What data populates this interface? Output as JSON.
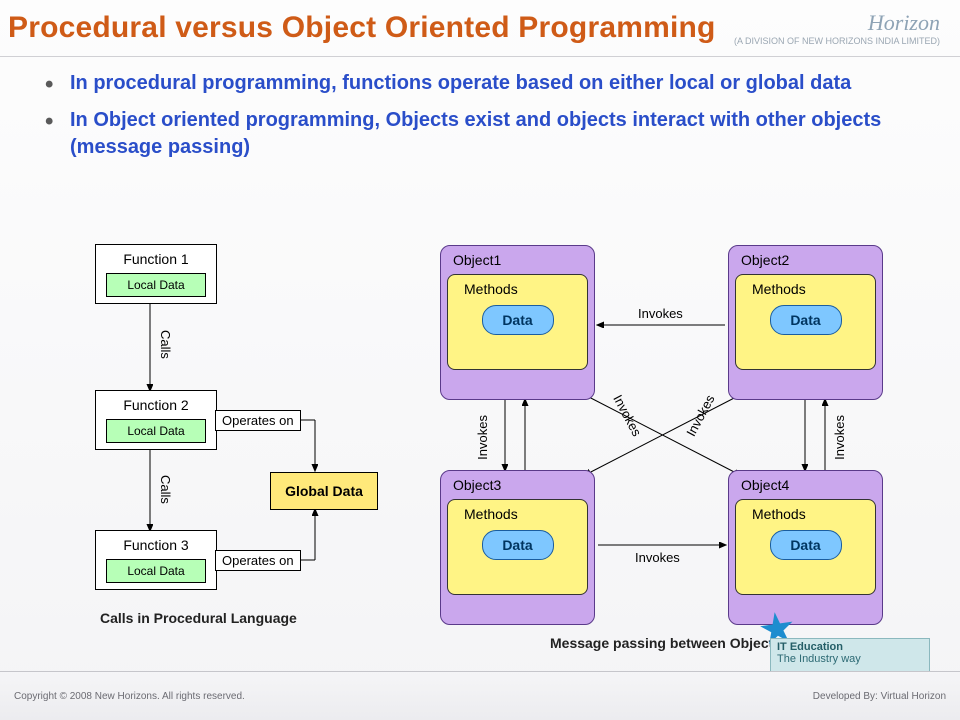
{
  "title": "Procedural versus Object Oriented Programming",
  "brand": {
    "name": "Horizon",
    "sub": "(A DIVISION OF NEW HORIZONS INDIA LIMITED)"
  },
  "bullets": [
    "In procedural programming, functions operate based on either local or global data",
    "In Object oriented programming, Objects exist and objects interact with other objects (message passing)"
  ],
  "left": {
    "f1": "Function 1",
    "f2": "Function 2",
    "f3": "Function 3",
    "ld": "Local Data",
    "gd": "Global Data",
    "calls": "Calls",
    "op": "Operates on",
    "caption": "Calls in Procedural Language"
  },
  "right": {
    "o1": "Object1",
    "o2": "Object2",
    "o3": "Object3",
    "o4": "Object4",
    "methods": "Methods",
    "data": "Data",
    "invokes": "Invokes",
    "caption": "Message passing between Objects"
  },
  "badge": {
    "l1": "IT Education",
    "l2": "The Industry way"
  },
  "footer": {
    "left": "Copyright © 2008 New Horizons. All rights reserved.",
    "right": "Developed By: Virtual Horizon"
  }
}
